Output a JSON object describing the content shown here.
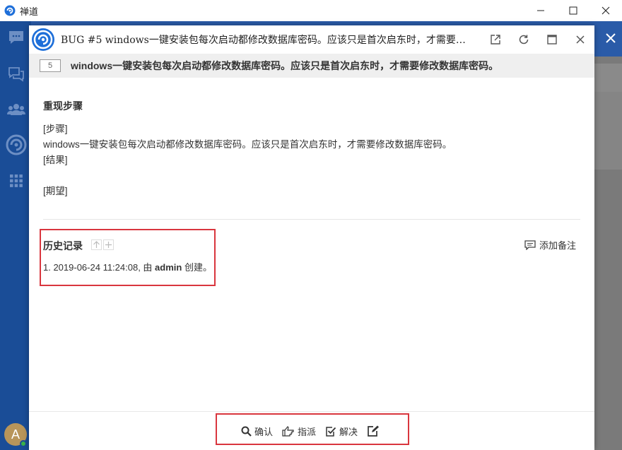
{
  "window": {
    "title": "禅道"
  },
  "modal": {
    "title": "BUG #5 windows一键安装包每次启动都修改数据库密码。应该只是首次启东时，才需要修...",
    "bug_id": "5",
    "bug_title": "windows一键安装包每次启动都修改数据库密码。应该只是首次启东时，才需要修改数据库密码。"
  },
  "steps": {
    "heading": "重现步骤",
    "step_label": "[步骤]",
    "step_text": "windows一键安装包每次启动都修改数据库密码。应该只是首次启东时，才需要修改数据库密码。",
    "result_label": "[结果]",
    "expect_label": "[期望]"
  },
  "history": {
    "heading": "历史记录",
    "add_note": "添加备注",
    "entry_prefix": "1. 2019-06-24 11:24:08, 由 ",
    "entry_user": "admin",
    "entry_suffix": " 创建。"
  },
  "footer": {
    "confirm": "确认",
    "assign": "指派",
    "resolve": "解决"
  },
  "avatar": {
    "letter": "A"
  },
  "colors": {
    "sidebar": "#1a4d97",
    "highlight": "#d9363e",
    "online": "#3bb34a"
  }
}
